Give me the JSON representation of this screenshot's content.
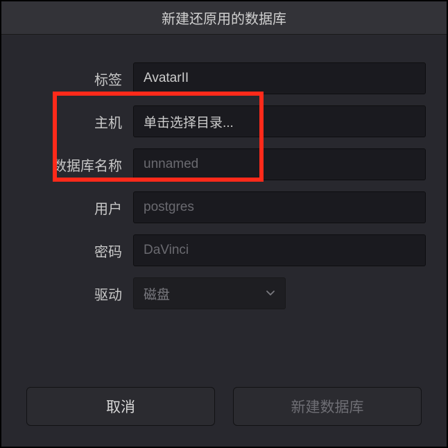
{
  "dialog": {
    "title": "新建还原用的数据库"
  },
  "form": {
    "label": {
      "text": "标签",
      "value": "AvatarII"
    },
    "host": {
      "text": "主机",
      "value": "单击选择目录..."
    },
    "dbname": {
      "text": "数据库名称",
      "placeholder": "unnamed"
    },
    "user": {
      "text": "用户",
      "placeholder": "postgres"
    },
    "password": {
      "text": "密码",
      "placeholder": "DaVinci"
    },
    "driver": {
      "text": "驱动",
      "value": "磁盘"
    }
  },
  "buttons": {
    "cancel": "取消",
    "create": "新建数据库"
  }
}
